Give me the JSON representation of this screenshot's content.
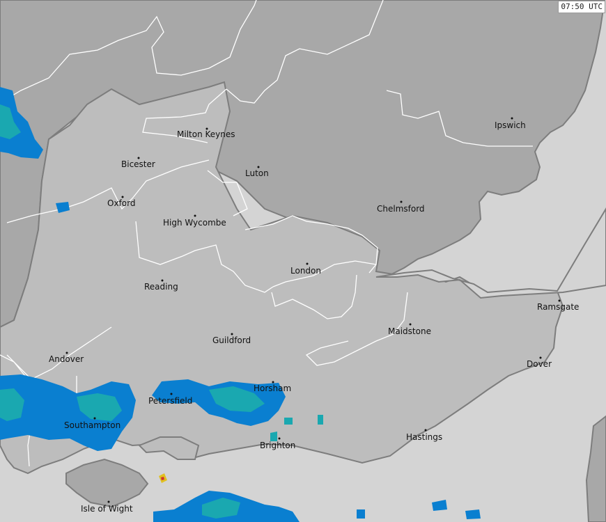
{
  "map": {
    "timestamp": "07:50 UTC",
    "colors": {
      "sea": "#d4d4d4",
      "land_region": "#a8a8a8",
      "land_inner": "#bdbdbd",
      "coast_stroke": "#7a7a7a",
      "boundary": "#ffffff",
      "rain_light": "#0a7fd0",
      "rain_moderate": "#1aa8b0",
      "rain_heavy": "#e0c020"
    },
    "places": [
      {
        "id": "milton-keynes",
        "name": "Milton Keynes"
      },
      {
        "id": "bicester",
        "name": "Bicester"
      },
      {
        "id": "luton",
        "name": "Luton"
      },
      {
        "id": "ipswich",
        "name": "Ipswich"
      },
      {
        "id": "oxford",
        "name": "Oxford"
      },
      {
        "id": "chelmsford",
        "name": "Chelmsford"
      },
      {
        "id": "high-wycombe",
        "name": "High Wycombe"
      },
      {
        "id": "london",
        "name": "London"
      },
      {
        "id": "reading",
        "name": "Reading"
      },
      {
        "id": "ramsgate",
        "name": "Ramsgate"
      },
      {
        "id": "maidstone",
        "name": "Maidstone"
      },
      {
        "id": "guildford",
        "name": "Guildford"
      },
      {
        "id": "andover",
        "name": "Andover"
      },
      {
        "id": "dover",
        "name": "Dover"
      },
      {
        "id": "horsham",
        "name": "Horsham"
      },
      {
        "id": "petersfield",
        "name": "Petersfield"
      },
      {
        "id": "southampton",
        "name": "Southampton"
      },
      {
        "id": "hastings",
        "name": "Hastings"
      },
      {
        "id": "brighton",
        "name": "Brighton"
      },
      {
        "id": "isle-of-wight",
        "name": "Isle of Wight"
      }
    ]
  }
}
